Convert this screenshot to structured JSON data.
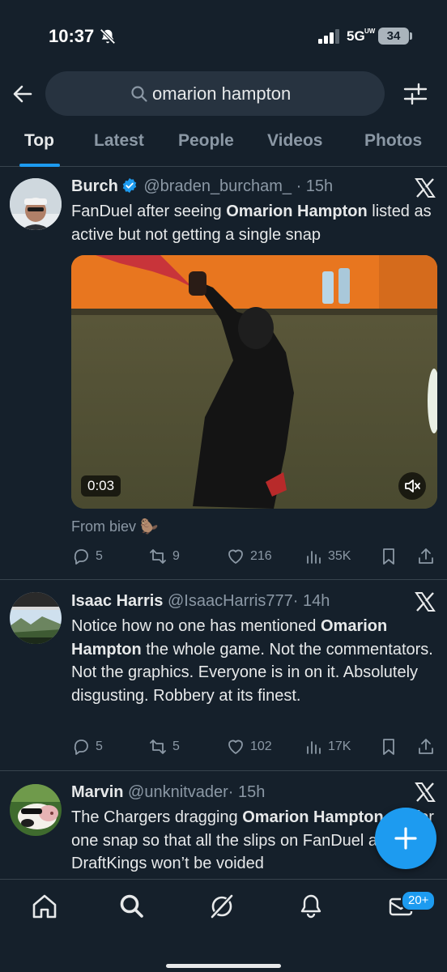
{
  "status": {
    "time": "10:37",
    "network": "5G",
    "network_sup": "UW",
    "battery": "34"
  },
  "search": {
    "query": "omarion hampton"
  },
  "tabs": [
    {
      "label": "Top"
    },
    {
      "label": "Latest"
    },
    {
      "label": "People"
    },
    {
      "label": "Videos"
    },
    {
      "label": "Photos"
    }
  ],
  "tweets": [
    {
      "name": "Burch",
      "handle": "@braden_burcham_",
      "time": "· 15h",
      "text_parts": [
        "FanDuel after seeing ",
        "Omarion Hampton",
        " listed as active but not getting a single snap"
      ],
      "video_duration": "0:03",
      "from": "From biev 🦫",
      "replies": "5",
      "reposts": "9",
      "likes": "216",
      "views": "35K"
    },
    {
      "name": "Isaac Harris",
      "handle": "@IsaacHarris777",
      "time": "· 14h",
      "text_parts": [
        "Notice how no one has mentioned ",
        "Omarion Hampton",
        " the whole game. Not the commentators. Not the graphics. Everyone is in on it. Absolutely disgusting. Robbery at its finest."
      ],
      "replies": "5",
      "reposts": "5",
      "likes": "102",
      "views": "17K"
    },
    {
      "name": "Marvin",
      "handle": "@unknitvader",
      "time": "· 15h",
      "text_parts": [
        "The Chargers dragging ",
        "Omarion Hampton",
        " out for one snap so that all the slips on FanDuel and DraftKings won’t be voided"
      ]
    }
  ],
  "nav": {
    "messages_badge": "20+"
  },
  "colors": {
    "background": "#15202b",
    "accent": "#1d9bf0",
    "muted": "#8b98a5"
  }
}
